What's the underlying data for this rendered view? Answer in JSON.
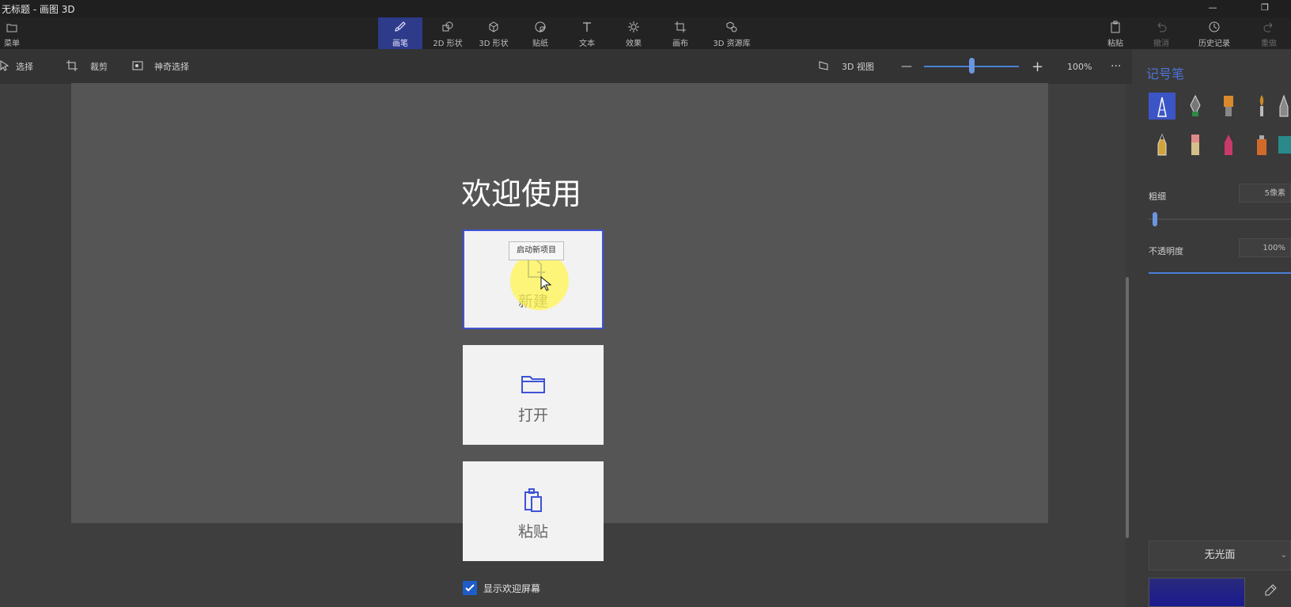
{
  "window": {
    "title": "无标题 - 画图 3D",
    "minimize": "—",
    "restore": "❐"
  },
  "ribbon": {
    "menu_label": "菜单",
    "tabs": [
      {
        "label": "画笔"
      },
      {
        "label": "2D 形状"
      },
      {
        "label": "3D 形状"
      },
      {
        "label": "贴纸"
      },
      {
        "label": "文本"
      },
      {
        "label": "效果"
      },
      {
        "label": "画布"
      },
      {
        "label": "3D 资源库"
      }
    ],
    "right": {
      "paste": "粘贴",
      "undo": "撤消",
      "history": "历史记录",
      "redo": "重做"
    }
  },
  "toolbar": {
    "select": "选择",
    "crop": "裁剪",
    "magic_select": "神奇选择",
    "view_3d": "3D 视图",
    "zoom_minus": "—",
    "zoom_plus": "+",
    "zoom_value": "100%",
    "more": "···",
    "zoom_level": 0.5
  },
  "welcome": {
    "title": "欢迎使用",
    "new_label": "新建",
    "open_label": "打开",
    "paste_label": "粘贴",
    "tooltip": "启动新项目",
    "show_welcome": "显示欢迎屏幕",
    "show_welcome_checked": true
  },
  "panel": {
    "title": "记号笔",
    "thickness_label": "粗细",
    "thickness_value": "5像素",
    "opacity_label": "不透明度",
    "opacity_value": "100%",
    "finish_value": "无光面",
    "colors": {
      "accent": "#3b55c7",
      "current_color": "#1b1b8f"
    }
  }
}
